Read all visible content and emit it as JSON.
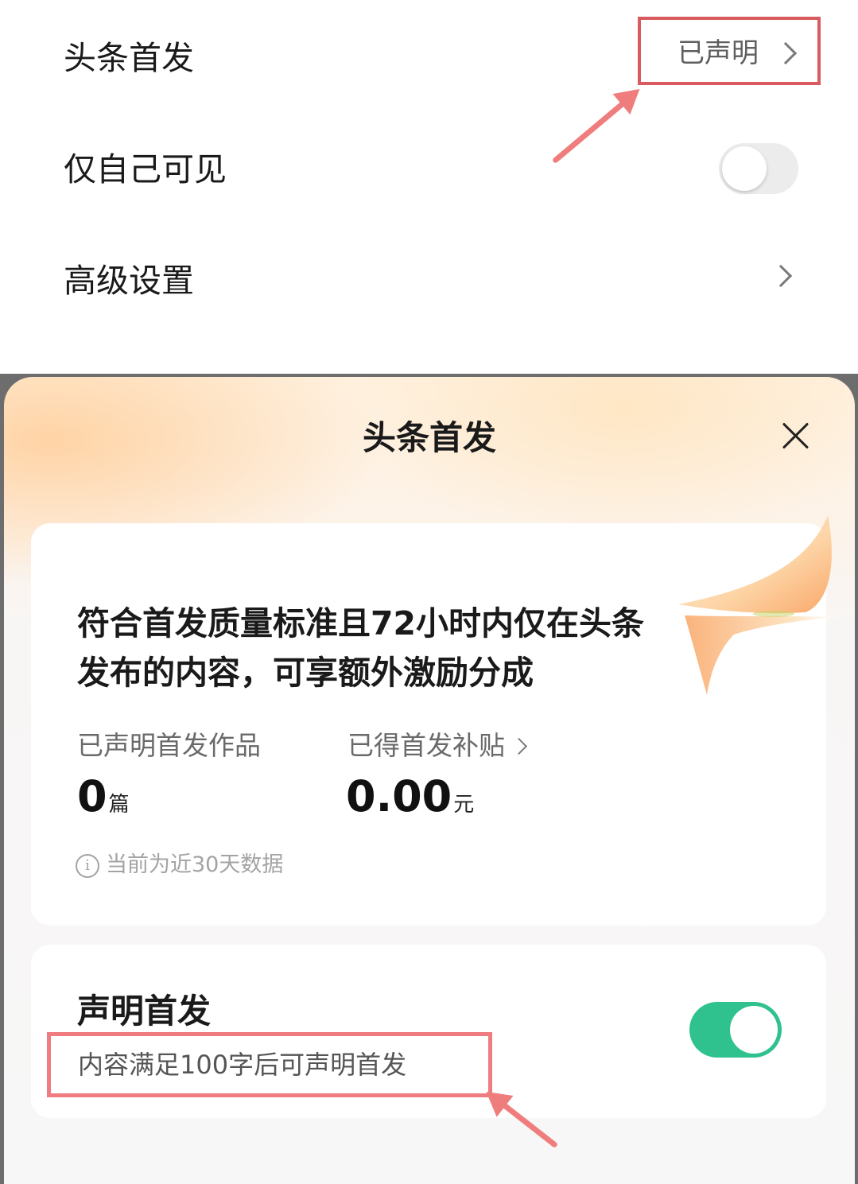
{
  "settings": {
    "first_publish": {
      "label": "头条首发",
      "status": "已声明"
    },
    "private": {
      "label": "仅自己可见",
      "enabled": false
    },
    "advanced": {
      "label": "高级设置"
    }
  },
  "sheet": {
    "title": "头条首发",
    "headline": "符合首发质量标准且72小时内仅在头条发布的内容，可享额外激励分成",
    "stats": [
      {
        "label": "已声明首发作品",
        "value": "0",
        "unit": "篇"
      },
      {
        "label": "已得首发补贴",
        "value": "0.00",
        "unit": "元"
      }
    ],
    "info": "当前为近30天数据",
    "declare": {
      "title": "声明首发",
      "description": "内容满足100字后可声明首发",
      "enabled": true
    }
  },
  "colors": {
    "highlight_box": "#d95b5f",
    "toggle_on": "#2fc28e",
    "arrow": "#f07d7d"
  }
}
